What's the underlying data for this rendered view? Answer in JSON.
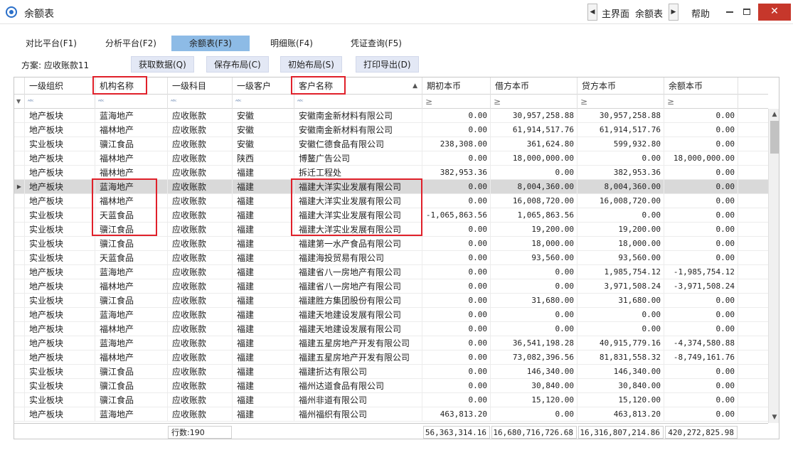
{
  "window": {
    "title": "余额表",
    "breadcrumb_home": "主界面",
    "breadcrumb_current": "余额表",
    "help": "帮助"
  },
  "tabs": [
    {
      "label": "对比平台(F1)",
      "active": false
    },
    {
      "label": "分析平台(F2)",
      "active": false
    },
    {
      "label": "余额表(F3)",
      "active": true
    },
    {
      "label": "明细账(F4)",
      "active": false
    },
    {
      "label": "凭证查询(F5)",
      "active": false
    }
  ],
  "toolbar": {
    "scheme_label": "方案: 应收账款11",
    "buttons": [
      "获取数据(Q)",
      "保存布局(C)",
      "初始布局(S)",
      "打印导出(D)"
    ]
  },
  "columns": [
    "一级组织",
    "机构名称",
    "一级科目",
    "一级客户",
    "客户名称",
    "期初本币",
    "借方本币",
    "贷方本币",
    "余额本币"
  ],
  "rows": [
    [
      "地产板块",
      "蓝海地产",
      "应收账款",
      "安徽",
      "安徽南金新材料有限公司",
      "0.00",
      "30,957,258.88",
      "30,957,258.88",
      "0.00"
    ],
    [
      "地产板块",
      "福林地产",
      "应收账款",
      "安徽",
      "安徽南金新材料有限公司",
      "0.00",
      "61,914,517.76",
      "61,914,517.76",
      "0.00"
    ],
    [
      "实业板块",
      "骥江食品",
      "应收账款",
      "安徽",
      "安徽仁德食品有限公司",
      "238,308.00",
      "361,624.80",
      "599,932.80",
      "0.00"
    ],
    [
      "地产板块",
      "福林地产",
      "应收账款",
      "陕西",
      "博鳌广告公司",
      "0.00",
      "18,000,000.00",
      "0.00",
      "18,000,000.00"
    ],
    [
      "地产板块",
      "福林地产",
      "应收账款",
      "福建",
      "拆迁工程处",
      "382,953.36",
      "0.00",
      "382,953.36",
      "0.00"
    ],
    [
      "地产板块",
      "蓝海地产",
      "应收账款",
      "福建",
      "福建大洋实业发展有限公司",
      "0.00",
      "8,004,360.00",
      "8,004,360.00",
      "0.00"
    ],
    [
      "地产板块",
      "福林地产",
      "应收账款",
      "福建",
      "福建大洋实业发展有限公司",
      "0.00",
      "16,008,720.00",
      "16,008,720.00",
      "0.00"
    ],
    [
      "实业板块",
      "天蓝食品",
      "应收账款",
      "福建",
      "福建大洋实业发展有限公司",
      "-1,065,863.56",
      "1,065,863.56",
      "0.00",
      "0.00"
    ],
    [
      "实业板块",
      "骥江食品",
      "应收账款",
      "福建",
      "福建大洋实业发展有限公司",
      "0.00",
      "19,200.00",
      "19,200.00",
      "0.00"
    ],
    [
      "实业板块",
      "骥江食品",
      "应收账款",
      "福建",
      "福建第一水产食品有限公司",
      "0.00",
      "18,000.00",
      "18,000.00",
      "0.00"
    ],
    [
      "实业板块",
      "天蓝食品",
      "应收账款",
      "福建",
      "福建海投贸易有限公司",
      "0.00",
      "93,560.00",
      "93,560.00",
      "0.00"
    ],
    [
      "地产板块",
      "蓝海地产",
      "应收账款",
      "福建",
      "福建省八一房地产有限公司",
      "0.00",
      "0.00",
      "1,985,754.12",
      "-1,985,754.12"
    ],
    [
      "地产板块",
      "福林地产",
      "应收账款",
      "福建",
      "福建省八一房地产有限公司",
      "0.00",
      "0.00",
      "3,971,508.24",
      "-3,971,508.24"
    ],
    [
      "实业板块",
      "骥江食品",
      "应收账款",
      "福建",
      "福建胜方集团股份有限公司",
      "0.00",
      "31,680.00",
      "31,680.00",
      "0.00"
    ],
    [
      "地产板块",
      "蓝海地产",
      "应收账款",
      "福建",
      "福建天地建设发展有限公司",
      "0.00",
      "0.00",
      "0.00",
      "0.00"
    ],
    [
      "地产板块",
      "福林地产",
      "应收账款",
      "福建",
      "福建天地建设发展有限公司",
      "0.00",
      "0.00",
      "0.00",
      "0.00"
    ],
    [
      "地产板块",
      "蓝海地产",
      "应收账款",
      "福建",
      "福建五星房地产开发有限公司",
      "0.00",
      "36,541,198.28",
      "40,915,779.16",
      "-4,374,580.88"
    ],
    [
      "地产板块",
      "福林地产",
      "应收账款",
      "福建",
      "福建五星房地产开发有限公司",
      "0.00",
      "73,082,396.56",
      "81,831,558.32",
      "-8,749,161.76"
    ],
    [
      "实业板块",
      "骥江食品",
      "应收账款",
      "福建",
      "福建折达有限公司",
      "0.00",
      "146,340.00",
      "146,340.00",
      "0.00"
    ],
    [
      "实业板块",
      "骥江食品",
      "应收账款",
      "福建",
      "福州达道食品有限公司",
      "0.00",
      "30,840.00",
      "30,840.00",
      "0.00"
    ],
    [
      "实业板块",
      "骥江食品",
      "应收账款",
      "福建",
      "福州非道有限公司",
      "0.00",
      "15,120.00",
      "15,120.00",
      "0.00"
    ],
    [
      "地产板块",
      "蓝海地产",
      "应收账款",
      "福建",
      "福州福织有限公司",
      "463,813.20",
      "0.00",
      "463,813.20",
      "0.00"
    ]
  ],
  "selected_row_index": 5,
  "footer": {
    "row_count": "行数:190",
    "sum_opening": "56,363,314.16",
    "sum_debit": "16,680,716,726.68",
    "sum_credit": "16,316,807,214.86",
    "sum_balance": "420,272,825.98"
  },
  "colors": {
    "active_tab": "#8dbbe6",
    "toolbar_button": "#e3e8f5",
    "selected_row": "#d9d9d9",
    "highlight": "#e0202a",
    "close_button": "#c6372b"
  },
  "icons": [
    "app-logo-icon",
    "chevron-left-icon",
    "chevron-right-icon",
    "minimize-icon",
    "maximize-icon",
    "close-icon",
    "sort-asc-icon",
    "filter-icon",
    "abc-filter-icon",
    "greater-equal-filter-icon",
    "row-pointer-icon",
    "scroll-up-icon",
    "scroll-down-icon"
  ]
}
